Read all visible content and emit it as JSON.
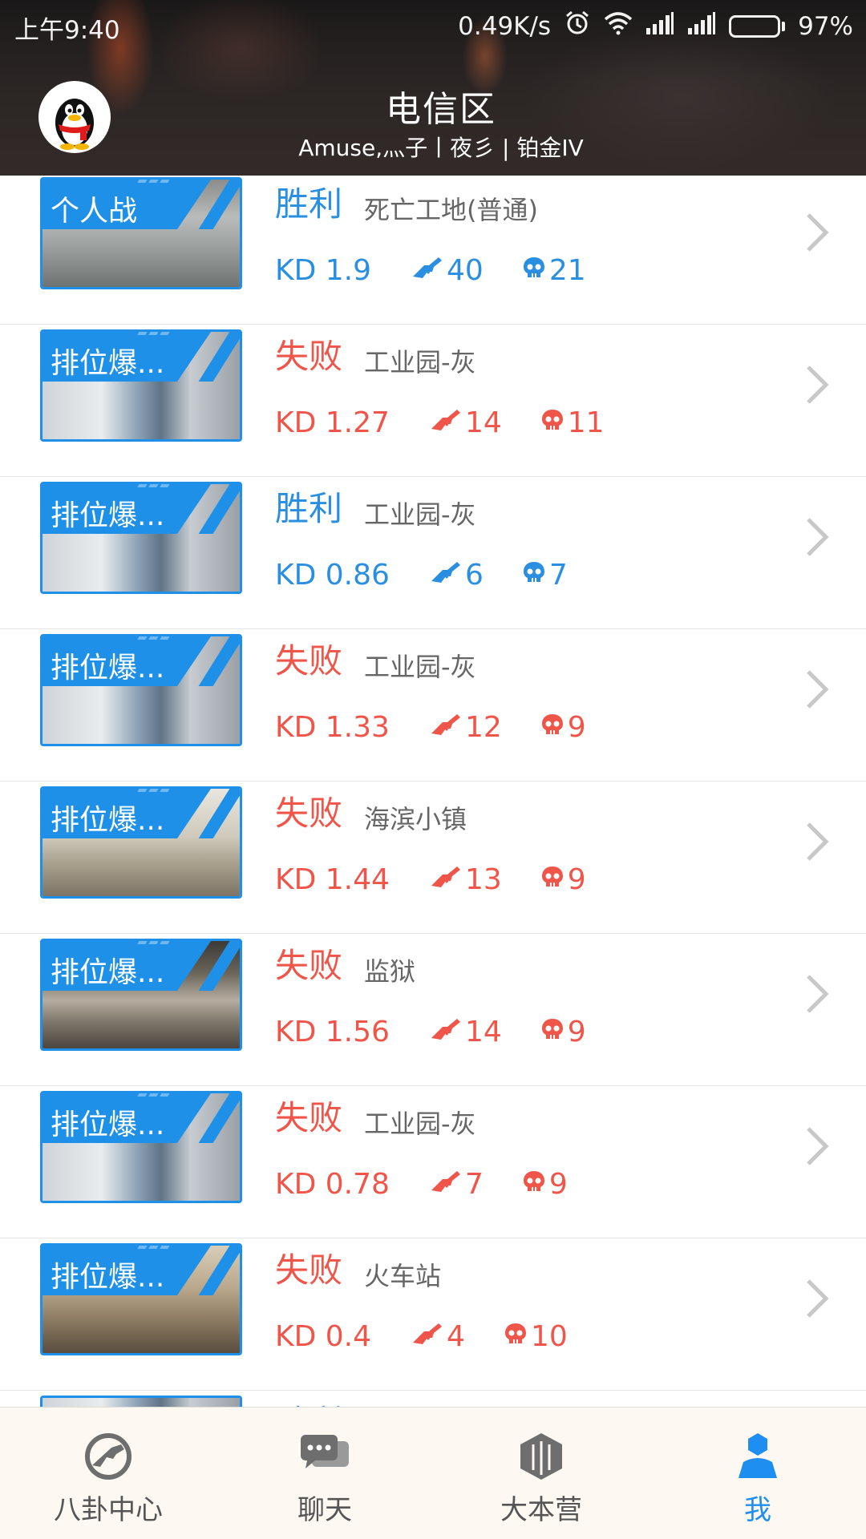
{
  "status_bar": {
    "time": "上午9:40",
    "speed": "0.49K/s",
    "battery": "97%",
    "battery_level": 0.97,
    "icons": [
      "alarm-icon",
      "wifi-icon",
      "signal-icon",
      "signal-icon",
      "battery-icon"
    ]
  },
  "header": {
    "title": "电信区",
    "subtitle": "Amuse,灬子丨夜彡 | 铂金IV",
    "avatar_icon": "qq-penguin-icon"
  },
  "colors": {
    "win": "#2a8fe0",
    "lose": "#f0554a",
    "banner": "#1e90e8",
    "tab_active": "#1e8ef0"
  },
  "matches": [
    {
      "mode": "个人战",
      "result": "胜利",
      "map": "死亡工地(普通)",
      "kd": "KD 1.9",
      "kills": "40",
      "deaths": "21",
      "outcome": "win",
      "scene": "grey"
    },
    {
      "mode": "排位爆...",
      "result": "失败",
      "map": "工业园-灰",
      "kd": "KD 1.27",
      "kills": "14",
      "deaths": "11",
      "outcome": "lose",
      "scene": "industrial"
    },
    {
      "mode": "排位爆...",
      "result": "胜利",
      "map": "工业园-灰",
      "kd": "KD 0.86",
      "kills": "6",
      "deaths": "7",
      "outcome": "win",
      "scene": "industrial"
    },
    {
      "mode": "排位爆...",
      "result": "失败",
      "map": "工业园-灰",
      "kd": "KD 1.33",
      "kills": "12",
      "deaths": "9",
      "outcome": "lose",
      "scene": "industrial"
    },
    {
      "mode": "排位爆...",
      "result": "失败",
      "map": "海滨小镇",
      "kd": "KD 1.44",
      "kills": "13",
      "deaths": "9",
      "outcome": "lose",
      "scene": "town"
    },
    {
      "mode": "排位爆...",
      "result": "失败",
      "map": "监狱",
      "kd": "KD 1.56",
      "kills": "14",
      "deaths": "9",
      "outcome": "lose",
      "scene": "prison"
    },
    {
      "mode": "排位爆...",
      "result": "失败",
      "map": "工业园-灰",
      "kd": "KD 0.78",
      "kills": "7",
      "deaths": "9",
      "outcome": "lose",
      "scene": "industrial"
    },
    {
      "mode": "排位爆...",
      "result": "失败",
      "map": "火车站",
      "kd": "KD 0.4",
      "kills": "4",
      "deaths": "10",
      "outcome": "lose",
      "scene": "station"
    },
    {
      "mode": "",
      "result": "胜利",
      "map": "",
      "kd": "",
      "kills": "",
      "deaths": "",
      "outcome": "win",
      "scene": "industrial"
    }
  ],
  "tabs": [
    {
      "label": "八卦中心",
      "icon": "gun-badge-icon",
      "active": false
    },
    {
      "label": "聊天",
      "icon": "chat-bubbles-icon",
      "active": false
    },
    {
      "label": "大本营",
      "icon": "hexagon-base-icon",
      "active": false
    },
    {
      "label": "我",
      "icon": "user-profile-icon",
      "active": true
    }
  ]
}
